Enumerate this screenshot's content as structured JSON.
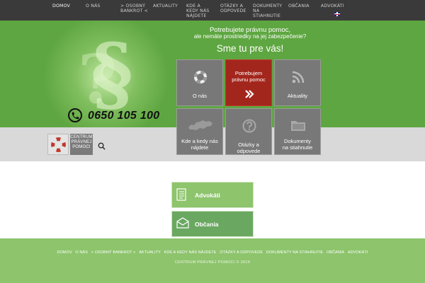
{
  "nav": {
    "items": [
      {
        "label": "DOMOV",
        "active": true
      },
      {
        "label": "O NÁS"
      },
      {
        "label": "> OSOBNÝ BANKROT <"
      },
      {
        "label": "AKTUALITY"
      },
      {
        "label": "KDE A KEDY NÁS NÁJDETE"
      },
      {
        "label": "OTÁZKY A ODPOVEDE"
      },
      {
        "label": "DOKUMENTY NA STIAHNUTIE"
      },
      {
        "label": "OBČANIA"
      },
      {
        "label": "ADVOKÁTI"
      }
    ],
    "language_icon": "uk-flag-icon"
  },
  "hero": {
    "line1": "Potrebujete právnu pomoc,",
    "line2": "ale nemáte prostriedky na jej zabezpečenie?",
    "line3": "Sme tu pre vás!",
    "phone": "0650 105 100"
  },
  "logo": {
    "line1": "CENTRUM",
    "line2": "PRÁVNEJ",
    "line3": "POMOCI"
  },
  "tiles": [
    {
      "label": "O nás",
      "icon": "lifebuoy-icon"
    },
    {
      "label": "Potrebujem\nprávnu pomoc",
      "icon": "double-chevron-right-icon"
    },
    {
      "label": "Aktuality",
      "icon": "rss-icon"
    },
    {
      "label": "Kde a kedy nás\nnájdete",
      "icon": "slovakia-map-icon"
    },
    {
      "label": "Otázky a odpovede",
      "icon": "question-icon"
    },
    {
      "label": "Dokumenty\nna stiahnutie",
      "icon": "folder-icon"
    }
  ],
  "cards": [
    {
      "label": "Advokáti",
      "icon": "document-icon"
    },
    {
      "label": "Občania",
      "icon": "envelope-icon"
    }
  ],
  "footer": {
    "links": [
      "DOMOV",
      "O NÁS",
      "> OSOBNÝ BANKROT <",
      "AKTUALITY",
      "KDE A KEDY NÁS NÁJDETE",
      "OTÁZKY A ODPOVEDE",
      "DOKUMENTY NA STIAHNUTIE",
      "OBČANIA",
      "ADVOKÁTI"
    ],
    "copyright": "CENTRUM PRÁVNEJ POMOCI © 2014"
  },
  "colors": {
    "nav_bg": "#3a3a3a",
    "hero_green": "#5ea641",
    "tile_grey": "#787878",
    "tile_red": "#a3261d",
    "card_green": "#8dc46c",
    "card_green_dark": "#6aa862",
    "footer_green": "#8dc46c"
  }
}
